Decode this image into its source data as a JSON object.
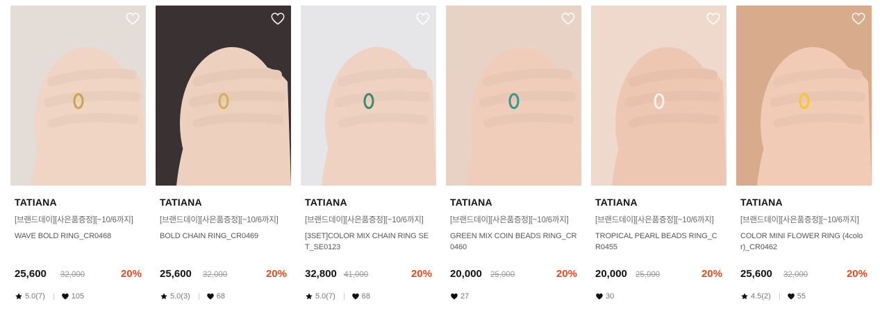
{
  "products": [
    {
      "brand": "TATIANA",
      "promo": "[브랜드데이][사은품증정][~10/6까지]",
      "name": "WAVE BOLD RING_CR0468",
      "price": "25,600",
      "original_price": "32,000",
      "discount": "20%",
      "rating": "5.0(7)",
      "likes": "105",
      "photo": {
        "bg": "#e4dcd6",
        "skin": "#f0d4c4",
        "metal": "#c9a24a"
      }
    },
    {
      "brand": "TATIANA",
      "promo": "[브랜드데이][사은품증정][~10/6까지]",
      "name": "BOLD CHAIN RING_CR0469",
      "price": "25,600",
      "original_price": "32,000",
      "discount": "20%",
      "rating": "5.0(3)",
      "likes": "68",
      "photo": {
        "bg": "#3a3232",
        "skin": "#edd0bd",
        "metal": "#d4ae52"
      }
    },
    {
      "brand": "TATIANA",
      "promo": "[브랜드데이][사은품증정][~10/6까지]",
      "name": "[3SET]COLOR MIX CHAIN RING SET_SE0123",
      "price": "32,800",
      "original_price": "41,000",
      "discount": "20%",
      "rating": "5.0(7)",
      "likes": "68",
      "photo": {
        "bg": "#e6e6e8",
        "skin": "#efd2c2",
        "metal": "#3a8a6a"
      }
    },
    {
      "brand": "TATIANA",
      "promo": "[브랜드데이][사은품증정][~10/6까지]",
      "name": "GREEN MIX COIN BEADS RING_CR0460",
      "price": "20,000",
      "original_price": "25,000",
      "discount": "20%",
      "rating": "",
      "likes": "27",
      "photo": {
        "bg": "#e8d2c6",
        "skin": "#f0cdbb",
        "metal": "#2e9a8a"
      }
    },
    {
      "brand": "TATIANA",
      "promo": "[브랜드데이][사은품증정][~10/6까지]",
      "name": "TROPICAL PEARL BEADS RING_CR0455",
      "price": "20,000",
      "original_price": "25,000",
      "discount": "20%",
      "rating": "",
      "likes": "30",
      "photo": {
        "bg": "#efd9cc",
        "skin": "#eec7b3",
        "metal": "#f4f0ea"
      }
    },
    {
      "brand": "TATIANA",
      "promo": "[브랜드데이][사은품증정][~10/6까지]",
      "name": "COLOR MINI FLOWER RING (4color)_CR0462",
      "price": "25,600",
      "original_price": "32,000",
      "discount": "20%",
      "rating": "4.5(2)",
      "likes": "55",
      "photo": {
        "bg": "#d8ab8c",
        "skin": "#f1cbb6",
        "metal": "#f2c82a"
      }
    }
  ],
  "icons": {
    "wishlist": "heart-outline-icon",
    "rating": "star-icon",
    "likes": "heart-filled-icon"
  },
  "colors": {
    "discount": "#e8481f",
    "price": "#111111",
    "original_price": "#999999"
  }
}
